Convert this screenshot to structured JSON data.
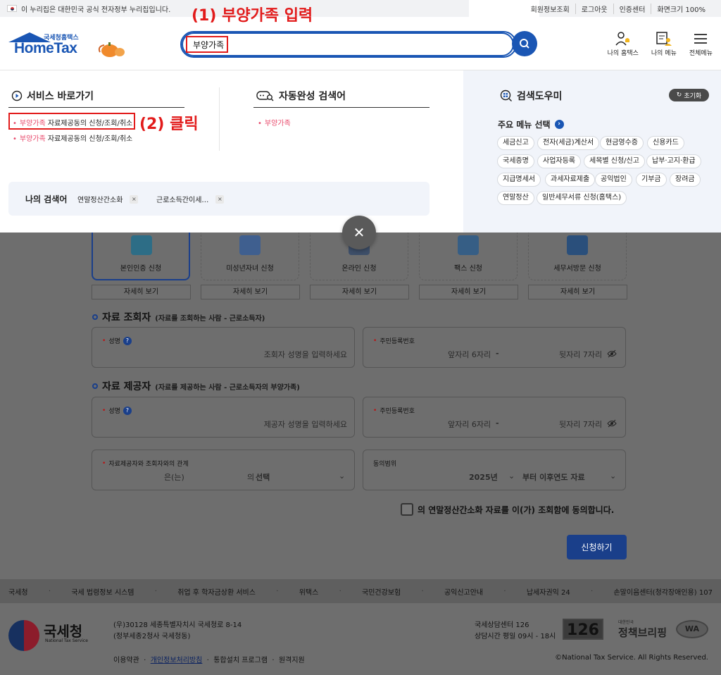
{
  "gov_bar": {
    "text": "이 누리집은 대한민국 공식 전자정부 누리집입니다."
  },
  "util_links": [
    "회원정보조회",
    "로그아웃",
    "인증센터",
    "화면크기 100%"
  ],
  "logo": {
    "sub": "국세청홈택스",
    "main": "HomeTax"
  },
  "search": {
    "value": "부양가족"
  },
  "annotations": {
    "step1": "(1) 부양가족 입력",
    "step2": "(2) 클릭"
  },
  "header_icons": [
    {
      "label": "나의 홈택스",
      "icon": "user-bell-icon"
    },
    {
      "label": "나의 메뉴",
      "icon": "user-doc-icon"
    },
    {
      "label": "전체메뉴",
      "icon": "hamburger-icon"
    }
  ],
  "service_shortcut": {
    "title": "서비스 바로가기",
    "links": [
      {
        "highlight": "부양가족",
        "rest": " 자료제공동의 신청/조회/취소"
      },
      {
        "highlight": "부양가족",
        "rest": " 자료제공동의 신청/조회/취소"
      }
    ]
  },
  "autocomplete": {
    "title": "자동완성 검색어",
    "items": [
      "부양가족"
    ]
  },
  "my_search": {
    "label": "나의 검색어",
    "items": [
      "연말정산간소화",
      "근로소득간이세…"
    ]
  },
  "search_helper": {
    "title": "검색도우미",
    "reset": "초기화",
    "menu_select": "주요 메뉴 선택",
    "tags": [
      "세금신고",
      "전자(세금)계산서",
      "현금영수증",
      "신용카드",
      "국세증명",
      "사업자등록",
      "세목별 신청/신고",
      "납부·고지·환급",
      "지급명세서",
      "과세자료제출",
      "공익법인",
      "기부금",
      "장려금",
      "연말정산",
      "일반세무서류 신청(홈택스)"
    ]
  },
  "methods": [
    {
      "label": "본인인증 신청",
      "color": "#2d6d86"
    },
    {
      "label": "미성년자녀 신청",
      "color": "#3f5f8f"
    },
    {
      "label": "온라인 신청",
      "color": "#3e4f69"
    },
    {
      "label": "팩스 신청",
      "color": "#365e85"
    },
    {
      "label": "세무서방문 신청",
      "color": "#2a4f7b"
    }
  ],
  "detail_label": "자세히 보기",
  "viewer": {
    "title": "자료 조회자",
    "desc": "(자료를 조회하는 사람 - 근로소득자)",
    "name_label": "성명",
    "name_ph": "조회자 성명을 입력하세요",
    "rrn_label": "주민등록번호",
    "front_ph": "앞자리 6자리",
    "dash": "-",
    "back_ph": "뒷자리 7자리"
  },
  "provider": {
    "title": "자료 제공자",
    "desc": "(자료를 제공하는 사람 - 근로소득자의 부양가족)",
    "name_label": "성명",
    "name_ph": "제공자 성명을 입력하세요",
    "rrn_label": "주민등록번호",
    "front_ph": "앞자리 6자리",
    "dash": "-",
    "back_ph": "뒷자리 7자리"
  },
  "relation": {
    "label": "자료제공자와 조회자와의 관계",
    "left": "은(는)",
    "mid": "의",
    "value": "선택"
  },
  "scope": {
    "label": "동의범위",
    "year": "2025년",
    "rest": "부터 이후연도 자료"
  },
  "agree_text": "의 연말정산간소화 자료를 이(가) 조회함에 동의합니다.",
  "submit": "신청하기",
  "footer_links": [
    "국세청",
    "국세 법령정보 시스템",
    "취업 후 학자금상환 서비스",
    "위택스",
    "국민건강보험",
    "공익신고안내",
    "납세자권익 24",
    "손말이음센터(청각장애인용) 107"
  ],
  "footer": {
    "org": "국세청",
    "org_en": "National Tax Service",
    "addr1": "(우)30128 세종특별자치시 국세청로 8-14",
    "addr2": "(정부세종2청사 국세청동)",
    "center1": "국세상담센터 126",
    "center2": "상담시간 평일 09시 - 18시",
    "badge126": "126",
    "policy_small": "대한민국",
    "policy": "정책브리핑",
    "wa": "WA",
    "terms": "이용약관",
    "privacy": "개인정보처리방침",
    "install": "통합설치 프로그램",
    "remote": "원격지원",
    "copyright": "©National Tax Service. All Rights Reserved."
  }
}
